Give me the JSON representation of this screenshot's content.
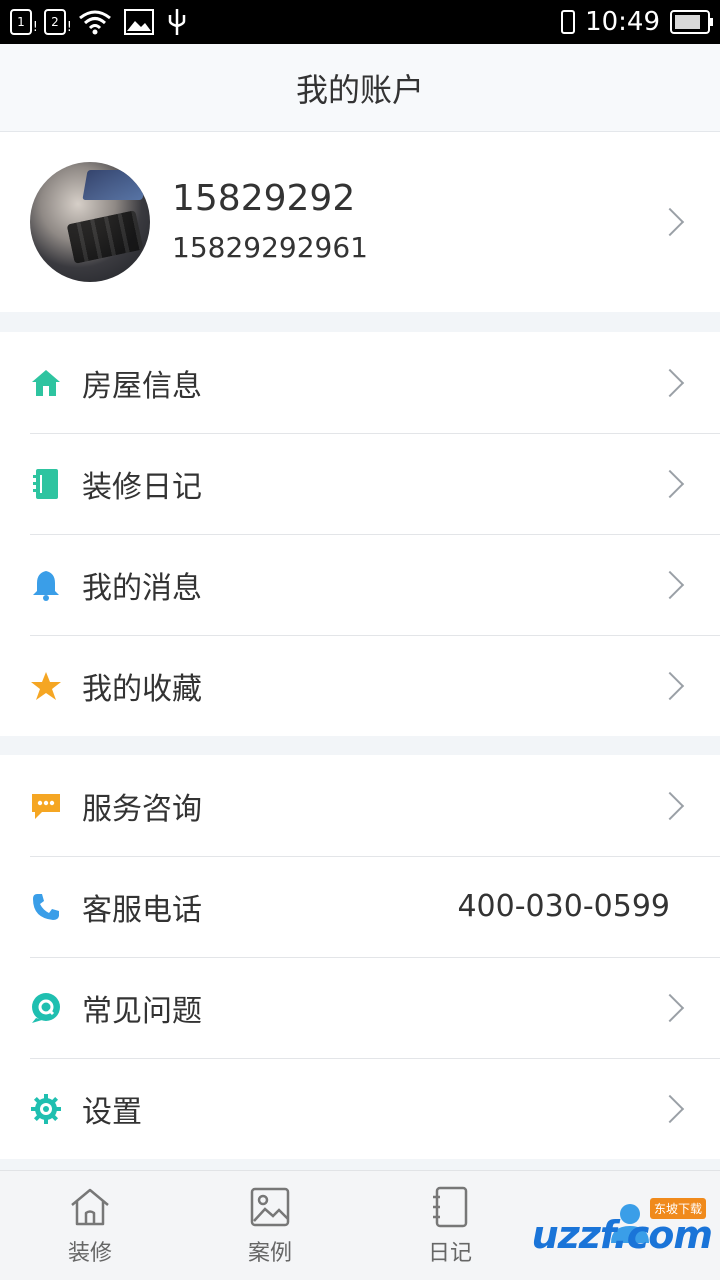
{
  "status_bar": {
    "sim1": "1",
    "sim2": "2",
    "time": "10:49"
  },
  "header": {
    "title": "我的账户"
  },
  "profile": {
    "name": "15829292",
    "phone": "15829292961"
  },
  "menu_group_1": [
    {
      "label": "房屋信息",
      "icon": "house-icon",
      "color": "#2ec4a0"
    },
    {
      "label": "装修日记",
      "icon": "notebook-icon",
      "color": "#2ec4a0"
    },
    {
      "label": "我的消息",
      "icon": "bell-icon",
      "color": "#3a9ee8"
    },
    {
      "label": "我的收藏",
      "icon": "star-icon",
      "color": "#f5a623"
    }
  ],
  "menu_group_2": [
    {
      "label": "服务咨询",
      "icon": "chat-icon",
      "color": "#f5a623"
    },
    {
      "label": "客服电话",
      "icon": "phone-icon",
      "color": "#3a9ee8",
      "value": "400-030-0599"
    },
    {
      "label": "常见问题",
      "icon": "faq-icon",
      "color": "#1fbfb0"
    },
    {
      "label": "设置",
      "icon": "gear-icon",
      "color": "#1fbfb0"
    }
  ],
  "tabbar": [
    {
      "label": "装修",
      "icon": "home-tab-icon"
    },
    {
      "label": "案例",
      "icon": "image-tab-icon"
    },
    {
      "label": "日记",
      "icon": "diary-tab-icon"
    },
    {
      "label": "",
      "icon": "user-tab-icon",
      "active": true
    }
  ],
  "watermark": {
    "text": "uzzf.com",
    "badge": "东坡下载"
  },
  "colors": {
    "accent": "#3a9ee8",
    "green": "#2ec4a0",
    "orange": "#f5a623"
  }
}
